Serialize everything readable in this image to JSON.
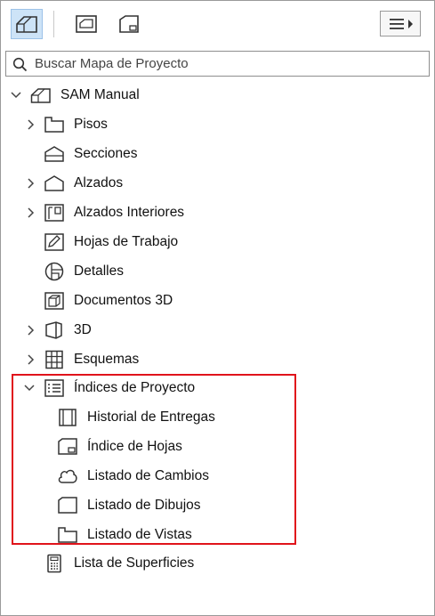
{
  "search": {
    "placeholder": "Buscar Mapa de Proyecto"
  },
  "tree": {
    "root": "SAM Manual",
    "items": {
      "pisos": "Pisos",
      "secciones": "Secciones",
      "alzados": "Alzados",
      "alzados_interiores": "Alzados Interiores",
      "hojas_trabajo": "Hojas de Trabajo",
      "detalles": "Detalles",
      "documentos_3d": "Documentos 3D",
      "tres_d": "3D",
      "esquemas": "Esquemas",
      "indices": "Índices de Proyecto",
      "historial": "Historial de Entregas",
      "indice_hojas": "Índice de Hojas",
      "listado_cambios": "Listado de Cambios",
      "listado_dibujos": "Listado de Dibujos",
      "listado_vistas": "Listado de Vistas",
      "lista_superficies": "Lista de Superficies"
    }
  },
  "colors": {
    "highlight": "#e0131b",
    "active_tab": "#cde3f7"
  }
}
